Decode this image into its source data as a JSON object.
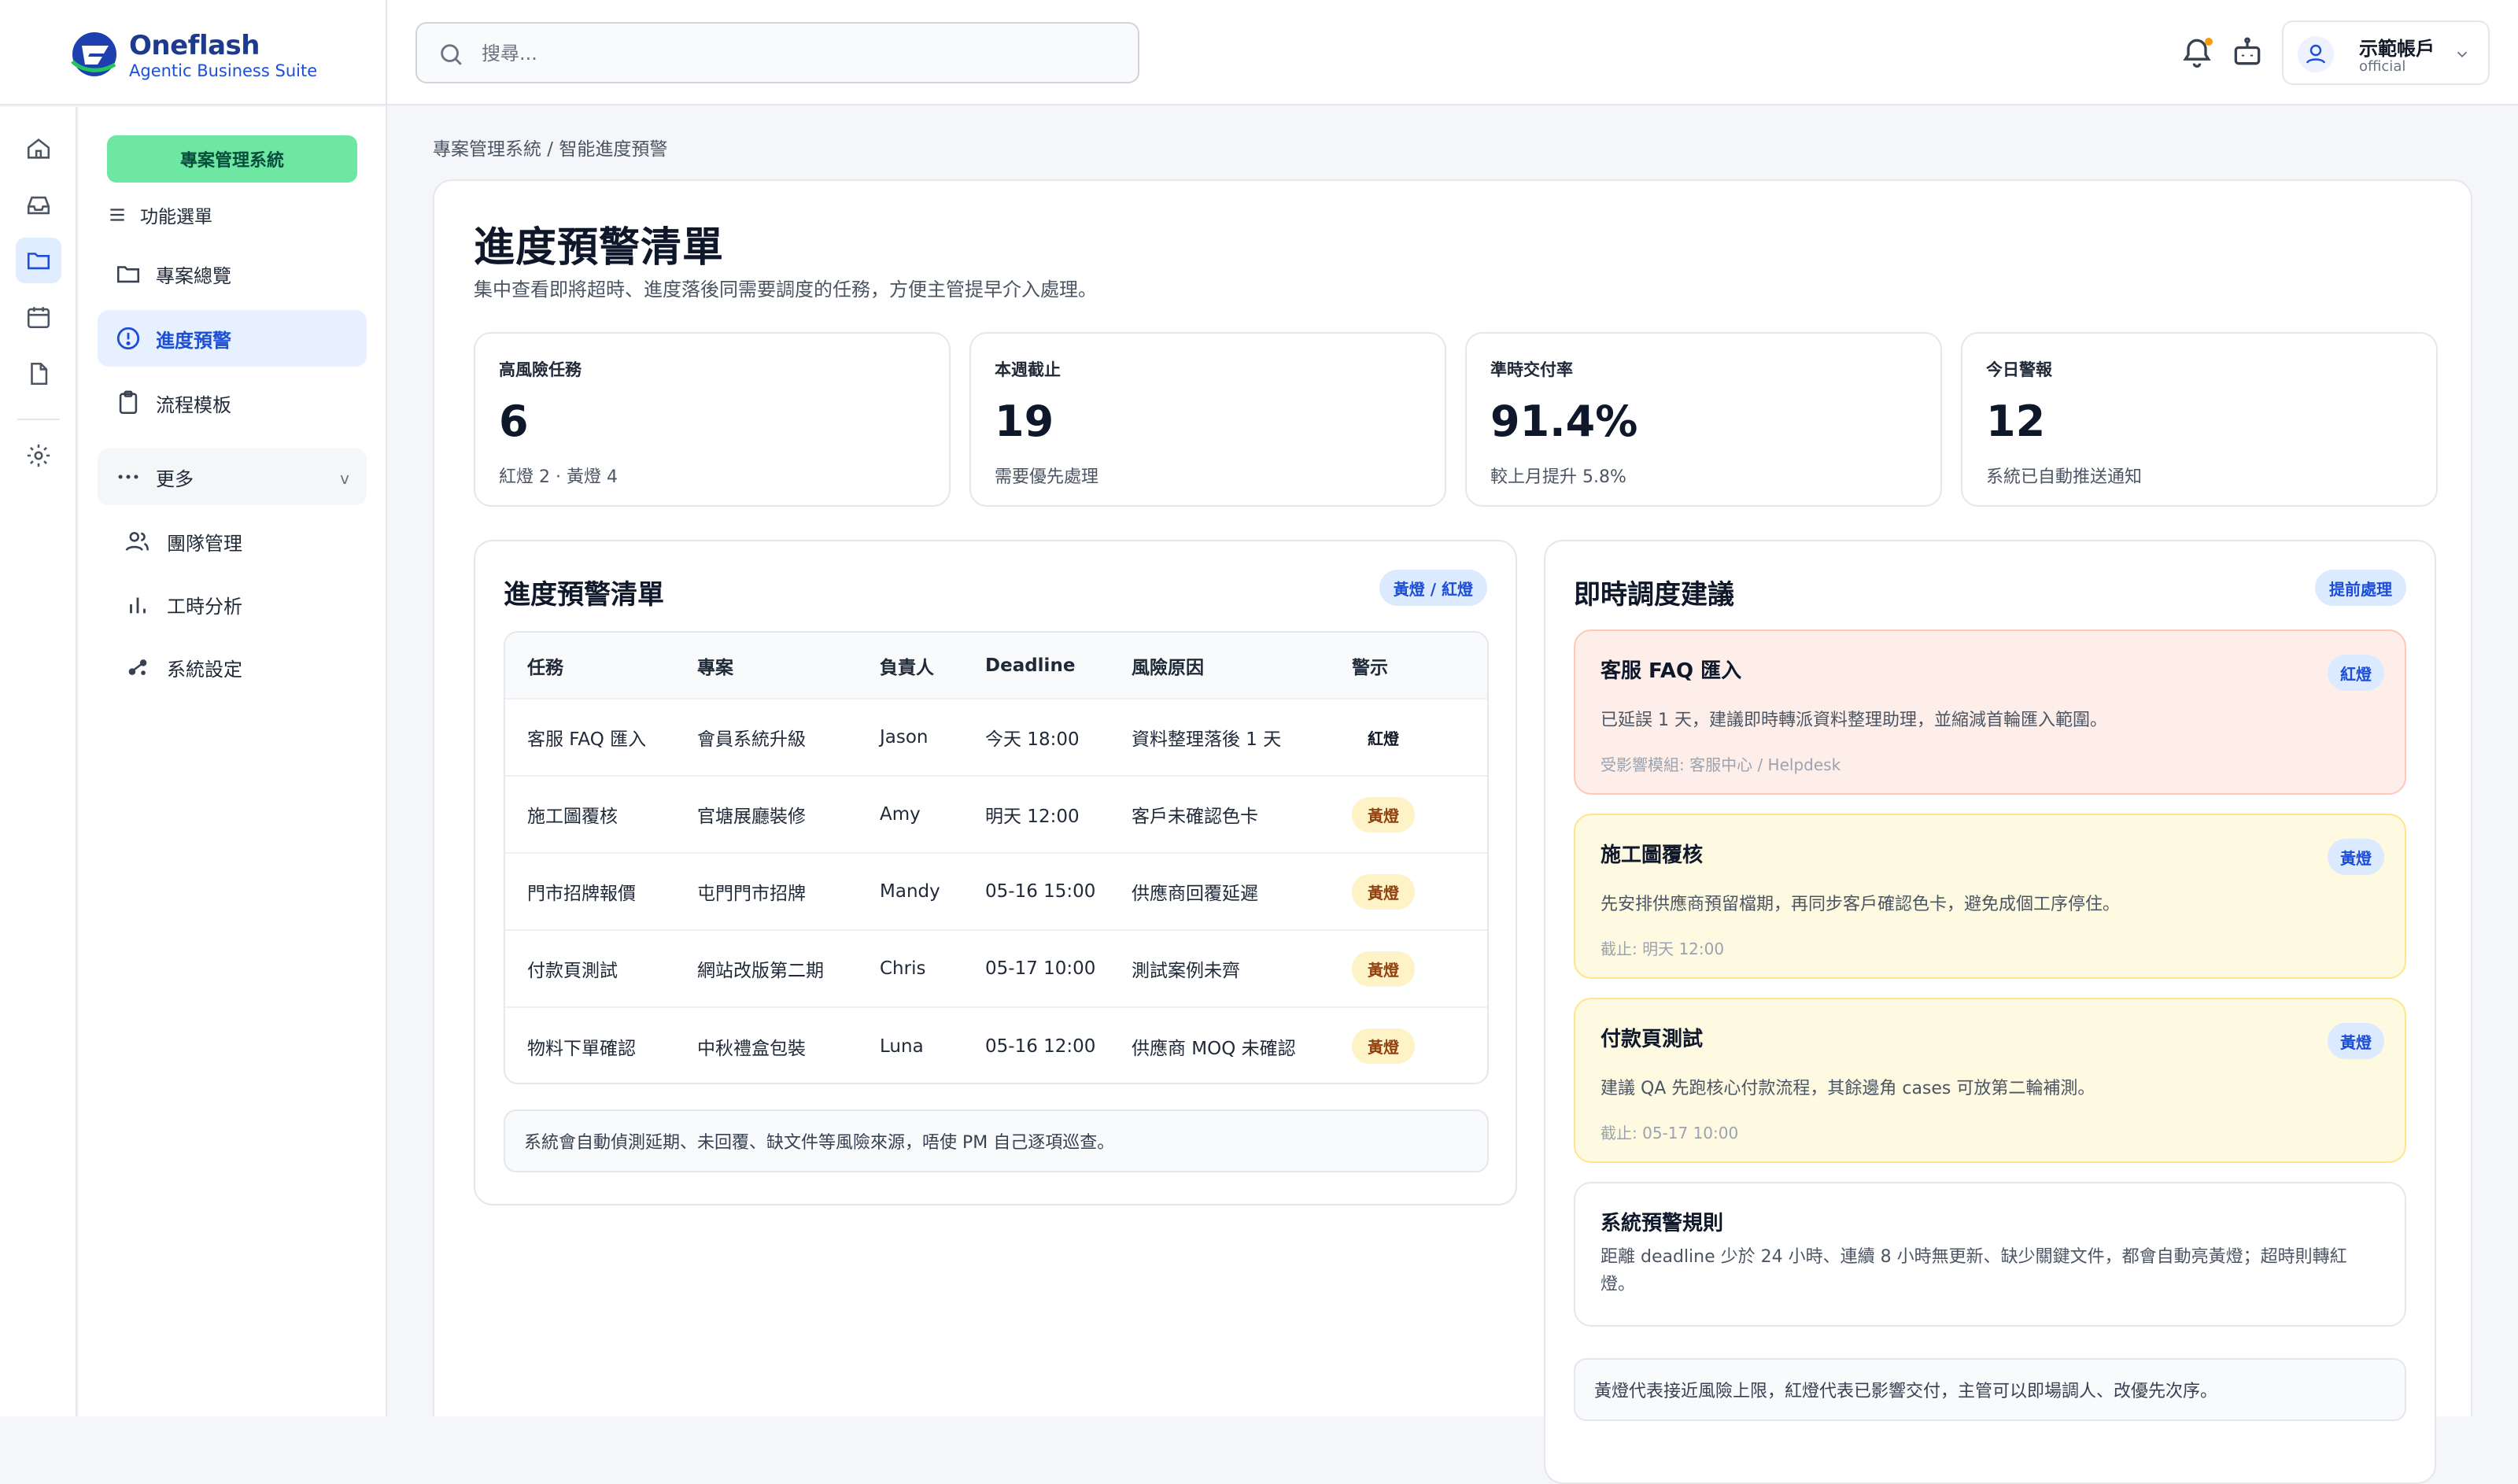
{
  "app": {
    "brand_name": "Oneflash",
    "brand_tagline": "Agentic Business Suite"
  },
  "header": {
    "search_placeholder": "搜尋...",
    "account_name": "示範帳戶",
    "account_sub": "official"
  },
  "sidebar": {
    "module_button": "專案管理系統",
    "menu_heading": "功能選單",
    "items": [
      {
        "label": "專案總覽"
      },
      {
        "label": "進度預警"
      },
      {
        "label": "流程模板"
      },
      {
        "label": "更多"
      }
    ],
    "more_chevron": "v",
    "sub_items": [
      {
        "label": "團隊管理"
      },
      {
        "label": "工時分析"
      },
      {
        "label": "系統設定"
      }
    ]
  },
  "breadcrumb": "專案管理系統 / 智能進度預警",
  "page": {
    "title": "進度預警清單",
    "subtitle": "集中查看即將超時、進度落後同需要調度的任務，方便主管提早介入處理。"
  },
  "stats": [
    {
      "label": "高風險任務",
      "value": "6",
      "note": "紅燈 2 · 黃燈 4"
    },
    {
      "label": "本週截止",
      "value": "19",
      "note": "需要優先處理"
    },
    {
      "label": "準時交付率",
      "value": "91.4%",
      "note": "較上月提升 5.8%"
    },
    {
      "label": "今日警報",
      "value": "12",
      "note": "系統已自動推送通知"
    }
  ],
  "warning_list": {
    "title": "進度預警清單",
    "pill": "黃燈 / 紅燈",
    "columns": [
      "任務",
      "專案",
      "負責人",
      "Deadline",
      "風險原因",
      "警示"
    ],
    "rows": [
      {
        "task": "客服 FAQ 匯入",
        "project": "會員系統升級",
        "owner": "Jason",
        "deadline": "今天 18:00",
        "reason": "資料整理落後 1 天",
        "alert": "紅燈",
        "level": "red"
      },
      {
        "task": "施工圖覆核",
        "project": "官塘展廳裝修",
        "owner": "Amy",
        "deadline": "明天 12:00",
        "reason": "客戶未確認色卡",
        "alert": "黃燈",
        "level": "yellow"
      },
      {
        "task": "門市招牌報價",
        "project": "屯門門市招牌",
        "owner": "Mandy",
        "deadline": "05-16 15:00",
        "reason": "供應商回覆延遲",
        "alert": "黃燈",
        "level": "yellow"
      },
      {
        "task": "付款頁測試",
        "project": "網站改版第二期",
        "owner": "Chris",
        "deadline": "05-17 10:00",
        "reason": "測試案例未齊",
        "alert": "黃燈",
        "level": "yellow"
      },
      {
        "task": "物料下單確認",
        "project": "中秋禮盒包裝",
        "owner": "Luna",
        "deadline": "05-16 12:00",
        "reason": "供應商 MOQ 未確認",
        "alert": "黃燈",
        "level": "yellow"
      }
    ],
    "footnote": "系統會自動偵測延期、未回覆、缺文件等風險來源，唔使 PM 自己逐項巡查。"
  },
  "suggestions": {
    "title": "即時調度建議",
    "pill": "提前處理",
    "items": [
      {
        "title": "客服 FAQ 匯入",
        "badge": "紅燈",
        "body": "已延誤 1 天，建議即時轉派資料整理助理，並縮減首輪匯入範圍。",
        "meta": "受影響模組: 客服中心 / Helpdesk"
      },
      {
        "title": "施工圖覆核",
        "badge": "黃燈",
        "body": "先安排供應商預留檔期，再同步客戶確認色卡，避免成個工序停住。",
        "meta": "截止: 明天 12:00"
      },
      {
        "title": "付款頁測試",
        "badge": "黃燈",
        "body": "建議 QA 先跑核心付款流程，其餘邊角 cases 可放第二輪補測。",
        "meta": "截止: 05-17 10:00"
      }
    ],
    "rules_title": "系統預警規則",
    "rules_body": "距離 deadline 少於 24 小時、連續 8 小時無更新、缺少關鍵文件，都會自動亮黃燈；超時則轉紅燈。",
    "footnote": "黃燈代表接近風險上限，紅燈代表已影響交付，主管可以即場調人、改優先次序。"
  },
  "icons": {
    "rail": [
      "home-icon",
      "inbox-icon",
      "folder-icon",
      "calendar-icon",
      "document-icon",
      "settings-icon"
    ],
    "header": [
      "bell-icon",
      "robot-icon",
      "user-icon",
      "chevron-down-icon"
    ],
    "sidebar": [
      "menu-icon",
      "folder-icon",
      "alert-circle-icon",
      "clipboard-icon",
      "more-dots-icon",
      "users-icon",
      "bar-chart-icon",
      "gear-share-icon"
    ]
  },
  "colors": {
    "accent": "#1d4ed8",
    "module_green": "#6ee7a2",
    "red_card": "#fdeee9",
    "yellow_card": "#fef9e1",
    "yellow_badge": "#fef3c7",
    "active_nav": "#e6f0ff"
  }
}
